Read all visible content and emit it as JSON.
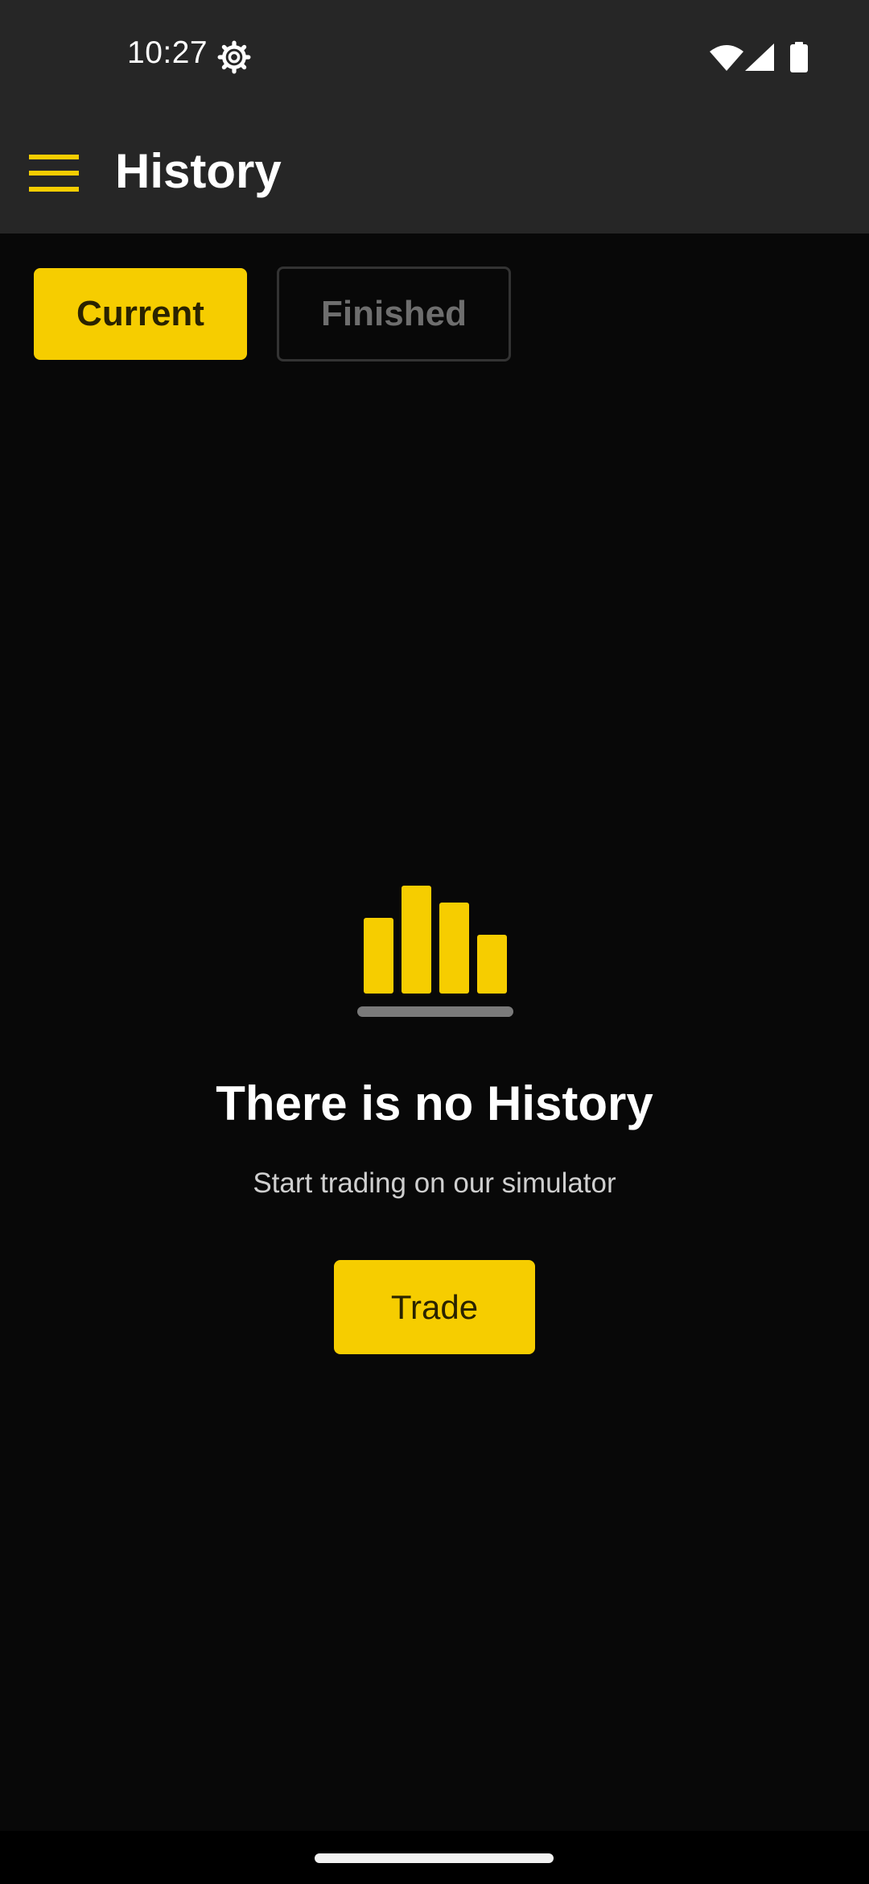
{
  "status_bar": {
    "time": "10:27",
    "icons": [
      "gear-icon",
      "wifi-icon",
      "signal-icon",
      "battery-icon"
    ]
  },
  "app_bar": {
    "title": "History",
    "menu_icon": "hamburger-menu-icon"
  },
  "tabs": [
    {
      "label": "Current",
      "selected": true
    },
    {
      "label": "Finished",
      "selected": false
    }
  ],
  "empty_state": {
    "icon": "bar-chart-icon",
    "title": "There is no History",
    "subtitle": "Start trading on our simulator",
    "button_label": "Trade"
  },
  "colors": {
    "accent": "#f6cd00",
    "background": "#080808",
    "bar_background": "#262626",
    "muted_text": "#6e6e6e"
  }
}
